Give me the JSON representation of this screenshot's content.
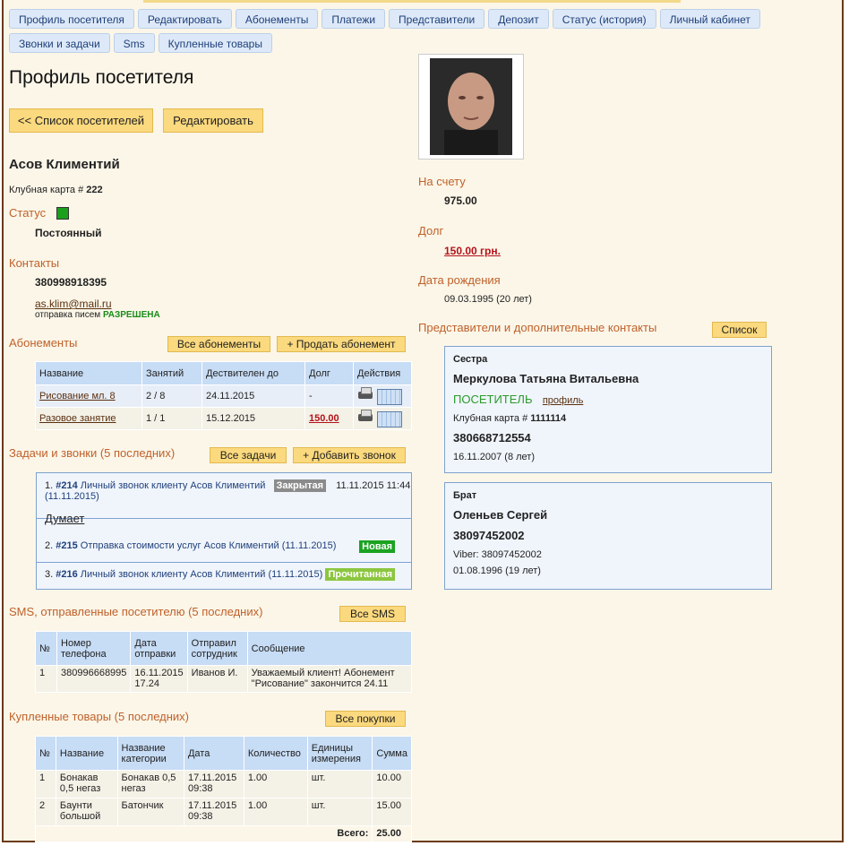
{
  "tabs_row1": [
    "Профиль посетителя",
    "Редактировать",
    "Абонементы",
    "Платежи",
    "Представители",
    "Депозит",
    "Статус (история)",
    "Личный кабинет"
  ],
  "tabs_row2": [
    "Звонки и задачи",
    "Sms",
    "Купленные товары"
  ],
  "page_title": "Профиль посетителя",
  "buttons": {
    "list": "<< Список посетителей",
    "edit": "Редактировать"
  },
  "visitor": {
    "name": "Асов Климентий",
    "card_label": "Клубная карта #",
    "card_number": "222",
    "status_label": "Статус",
    "status_value": "Постоянный",
    "status_color": "#19a01d",
    "contacts_label": "Контакты",
    "phone": "380998918395",
    "email": "as.klim@mail.ru",
    "mail_label": "отправка писем",
    "mail_value": "РАЗРЕШЕНА"
  },
  "memberships": {
    "title": "Абонементы",
    "btn_all": "Все абонементы",
    "btn_sell": "+ Продать абонемент",
    "columns": [
      "Название",
      "Занятий",
      "Дествителен до",
      "Долг",
      "Действия"
    ],
    "rows": [
      {
        "name": "Рисование мл. 8",
        "sessions": "2 / 8",
        "valid": "24.11.2015",
        "debt": "-"
      },
      {
        "name": "Разовое занятие",
        "sessions": "1 / 1",
        "valid": "15.12.2015",
        "debt": "150.00"
      }
    ]
  },
  "tasks": {
    "title": "Задачи и звонки (5 последних)",
    "btn_all": "Все задачи",
    "btn_add": "+ Добавить звонок",
    "items": [
      {
        "num": "1.",
        "id": "#214",
        "text": "Личный звонок клиенту Асов Климентий",
        "date": "11.11.2015 11:44",
        "sub": "(11.11.2015)",
        "badge": "Закрытая",
        "badge_color": "#8b8b8b",
        "note": "Думает"
      },
      {
        "num": "2.",
        "id": "#215",
        "text": "Отправка стоимости услуг Асов Климентий (11.11.2015)",
        "badge": "Новая",
        "badge_color": "#1aa321"
      },
      {
        "num": "3.",
        "id": "#216",
        "text": "Личный звонок клиенту Асов Климентий (11.11.2015)",
        "badge": "Прочитанная",
        "badge_color": "#8cc63f"
      }
    ]
  },
  "sms": {
    "title": "SMS, отправленные посетителю (5 последних)",
    "btn_all": "Все SMS",
    "columns": [
      "№",
      "Номер телефона",
      "Дата отправки",
      "Отправил сотрудник",
      "Сообщение"
    ],
    "rows": [
      {
        "n": "1",
        "phone": "380996668995",
        "date": "16.11.2015 17.24",
        "employee": "Иванов И.",
        "message": "Уважаемый клиент! Абонемент \"Рисование\" закончится 24.11"
      }
    ]
  },
  "goods": {
    "title": "Купленные товары (5 последних)",
    "btn_all": "Все покупки",
    "columns": [
      "№",
      "Название",
      "Название категории",
      "Дата",
      "Количество",
      "Единицы измерения",
      "Сумма"
    ],
    "rows": [
      {
        "n": "1",
        "name": "Бонакав 0,5 негаз",
        "category": "Бонакав 0,5 негаз",
        "date": "17.11.2015 09:38",
        "qty": "1.00",
        "unit": "шт.",
        "sum": "10.00"
      },
      {
        "n": "2",
        "name": "Баунти большой",
        "category": "Батончик",
        "date": "17.11.2015 09:38",
        "qty": "1.00",
        "unit": "шт.",
        "sum": "15.00"
      }
    ],
    "total_label": "Всего:",
    "total_value": "25.00"
  },
  "right": {
    "balance_label": "На счету",
    "balance_value": "975.00",
    "debt_label": "Долг",
    "debt_value": "150.00 грн.",
    "birth_label": "Дата рождения",
    "birth_value": "09.03.1995 (20 лет)",
    "reps_label": "Представители и дополнительные контакты",
    "reps_btn": "Список",
    "reps": [
      {
        "relation": "Сестра",
        "name": "Меркулова Татьяна Витальевна",
        "type": "ПОСЕТИТЕЛЬ",
        "profile": "профиль",
        "card_label": "Клубная карта #",
        "card": "1111114",
        "phone": "380668712554",
        "birth": "16.11.2007 (8 лет)"
      },
      {
        "relation": "Брат",
        "name": "Оленьев Сергей",
        "phone": "38097452002",
        "viber": "Viber: 38097452002",
        "birth": "01.08.1996 (19 лет)"
      }
    ]
  }
}
